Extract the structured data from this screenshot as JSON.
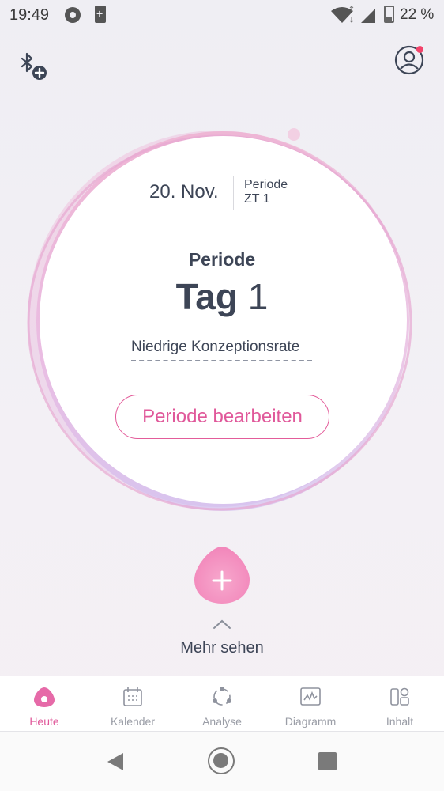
{
  "status_bar": {
    "time": "19:49",
    "battery": "22 %"
  },
  "colors": {
    "accent": "#e0589a",
    "text": "#3d4556",
    "inactive": "#9a9da6",
    "notification": "#f3426a"
  },
  "today_card": {
    "date": "20. Nov.",
    "cycle_phase": "Periode",
    "cycle_day": "ZT 1",
    "phase_title": "Periode",
    "day_prefix": "Tag",
    "day_number": "1",
    "conception_rate": "Niedrige Konzeptionsrate",
    "edit_button": "Periode bearbeiten"
  },
  "more": {
    "label": "Mehr sehen"
  },
  "bottom_nav": [
    {
      "label": "Heute",
      "icon": "drop-icon",
      "active": true
    },
    {
      "label": "Kalender",
      "icon": "calendar-icon",
      "active": false
    },
    {
      "label": "Analyse",
      "icon": "analysis-icon",
      "active": false
    },
    {
      "label": "Diagramm",
      "icon": "chart-icon",
      "active": false
    },
    {
      "label": "Inhalt",
      "icon": "content-grid-icon",
      "active": false
    }
  ],
  "icons": {
    "header_left": "bluetooth-add-icon",
    "header_right": "profile-icon",
    "add": "plus-icon",
    "more": "chevron-up-icon"
  }
}
